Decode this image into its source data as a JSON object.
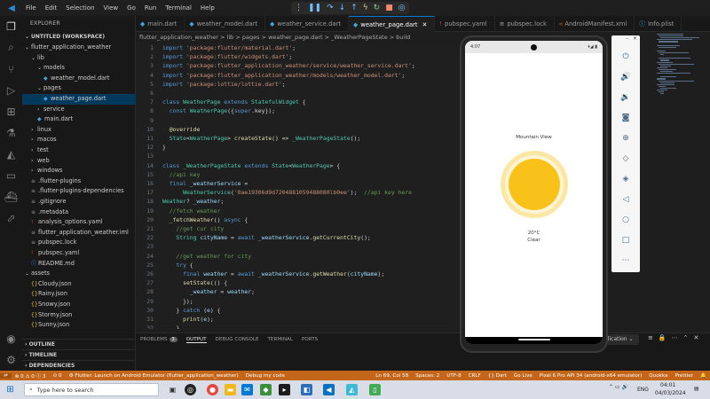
{
  "menu": [
    "File",
    "Edit",
    "Selection",
    "View",
    "Go",
    "Run",
    "Terminal",
    "Help"
  ],
  "explorer": {
    "title": "EXPLORER",
    "workspace": "UNTITLED (WORKSPACE)",
    "rows": [
      {
        "label": "flutter_application_weather",
        "depth": 0,
        "kind": "folder-open"
      },
      {
        "label": "lib",
        "depth": 1,
        "kind": "folder-open"
      },
      {
        "label": "models",
        "depth": 2,
        "kind": "folder-open"
      },
      {
        "label": "weather_model.dart",
        "depth": 3,
        "kind": "dart"
      },
      {
        "label": "pages",
        "depth": 2,
        "kind": "folder-open"
      },
      {
        "label": "weather_page.dart",
        "depth": 3,
        "kind": "dart",
        "selected": true
      },
      {
        "label": "service",
        "depth": 2,
        "kind": "folder"
      },
      {
        "label": "main.dart",
        "depth": 2,
        "kind": "dart"
      },
      {
        "label": "linux",
        "depth": 1,
        "kind": "folder"
      },
      {
        "label": "macos",
        "depth": 1,
        "kind": "folder"
      },
      {
        "label": "test",
        "depth": 1,
        "kind": "folder"
      },
      {
        "label": "web",
        "depth": 1,
        "kind": "folder"
      },
      {
        "label": "windows",
        "depth": 1,
        "kind": "folder"
      },
      {
        "label": ".flutter-plugins",
        "depth": 1,
        "kind": "file"
      },
      {
        "label": ".flutter-plugins-dependencies",
        "depth": 1,
        "kind": "file"
      },
      {
        "label": ".gitignore",
        "depth": 1,
        "kind": "file"
      },
      {
        "label": ".metadata",
        "depth": 1,
        "kind": "file"
      },
      {
        "label": "analysis_options.yaml",
        "depth": 1,
        "kind": "yaml"
      },
      {
        "label": "flutter_application_weather.iml",
        "depth": 1,
        "kind": "file"
      },
      {
        "label": "pubspec.lock",
        "depth": 1,
        "kind": "file"
      },
      {
        "label": "pubspec.yaml",
        "depth": 1,
        "kind": "yaml"
      },
      {
        "label": "README.md",
        "depth": 1,
        "kind": "info"
      },
      {
        "label": "assets",
        "depth": 0,
        "kind": "folder-open"
      },
      {
        "label": "Cloudy.json",
        "depth": 1,
        "kind": "json"
      },
      {
        "label": "Rainy.json",
        "depth": 1,
        "kind": "json"
      },
      {
        "label": "Snowy.json",
        "depth": 1,
        "kind": "json"
      },
      {
        "label": "Stormy.json",
        "depth": 1,
        "kind": "json"
      },
      {
        "label": "Sunny.json",
        "depth": 1,
        "kind": "json"
      }
    ],
    "sections": [
      "OUTLINE",
      "TIMELINE",
      "DEPENDENCIES"
    ]
  },
  "tabs": [
    {
      "label": "main.dart",
      "icon": "dart"
    },
    {
      "label": "weather_model.dart",
      "icon": "dart"
    },
    {
      "label": "weather_service.dart",
      "icon": "dart"
    },
    {
      "label": "weather_page.dart",
      "icon": "dart",
      "active": true
    },
    {
      "label": "pubspec.yaml",
      "icon": "yaml"
    },
    {
      "label": "pubspec.lock",
      "icon": "lock"
    },
    {
      "label": "AndroidManifest.xml",
      "icon": "xml"
    },
    {
      "label": "Info.plist",
      "icon": "plist"
    }
  ],
  "breadcrumb": "flutter_application_weather  >  lib  >  pages  >  weather_page.dart  >  _WeatherPageState  >  build",
  "code": [
    [
      [
        "kw",
        "import "
      ],
      [
        "str",
        "'package:flutter/material.dart'"
      ],
      [
        "pl",
        ";"
      ]
    ],
    [
      [
        "kw",
        "import "
      ],
      [
        "str",
        "'package:flutter/widgets.dart'"
      ],
      [
        "pl",
        ";"
      ]
    ],
    [
      [
        "kw",
        "import "
      ],
      [
        "str",
        "'package:flutter_application_weather/service/weather_service.dart'"
      ],
      [
        "pl",
        ";"
      ]
    ],
    [
      [
        "kw",
        "import "
      ],
      [
        "str",
        "'package:flutter_application_weather/models/weather_model.dart'"
      ],
      [
        "pl",
        ";"
      ]
    ],
    [
      [
        "kw",
        "import "
      ],
      [
        "str",
        "'package:lottie/lottie.dart'"
      ],
      [
        "pl",
        ";"
      ]
    ],
    [],
    [
      [
        "kw",
        "class "
      ],
      [
        "ty",
        "WeatherPage "
      ],
      [
        "kw",
        "extends "
      ],
      [
        "ty",
        "StatefulWidget "
      ],
      [
        "pl",
        "{"
      ]
    ],
    [
      [
        "pl",
        "  "
      ],
      [
        "kw",
        "const "
      ],
      [
        "ty",
        "WeatherPage"
      ],
      [
        "pl",
        "({"
      ],
      [
        "kw",
        "super"
      ],
      [
        "pl",
        ".key});"
      ]
    ],
    [],
    [
      [
        "pl",
        "  "
      ],
      [
        "an",
        "@override"
      ]
    ],
    [
      [
        "pl",
        "  "
      ],
      [
        "ty",
        "State"
      ],
      [
        "pl",
        "<"
      ],
      [
        "ty",
        "WeatherPage"
      ],
      [
        "pl",
        "> "
      ],
      [
        "fn",
        "createState"
      ],
      [
        "pl",
        "() => "
      ],
      [
        "ty",
        "_WeatherPageState"
      ],
      [
        "pl",
        "();"
      ]
    ],
    [
      [
        "pl",
        "}"
      ]
    ],
    [],
    [
      [
        "kw",
        "class "
      ],
      [
        "ty",
        "_WeatherPageState "
      ],
      [
        "kw",
        "extends "
      ],
      [
        "ty",
        "State"
      ],
      [
        "pl",
        "<"
      ],
      [
        "ty",
        "WeatherPage"
      ],
      [
        "pl",
        "> {"
      ]
    ],
    [
      [
        "pl",
        "  "
      ],
      [
        "cm",
        "//api key"
      ]
    ],
    [
      [
        "pl",
        "  "
      ],
      [
        "kw",
        "final "
      ],
      [
        "vr",
        "_weatherService "
      ],
      [
        "pl",
        "="
      ]
    ],
    [
      [
        "pl",
        "      "
      ],
      [
        "ty",
        "WeatherService"
      ],
      [
        "pl",
        "("
      ],
      [
        "str",
        "'0ae19306d9d7204881059488080lb0ee'"
      ],
      [
        "pl",
        ");  "
      ],
      [
        "cm",
        "//api key here"
      ]
    ],
    [
      [
        "ty",
        "Weather"
      ],
      [
        "pl",
        "? "
      ],
      [
        "vr",
        "_weather"
      ],
      [
        "pl",
        ";"
      ]
    ],
    [
      [
        "pl",
        "  "
      ],
      [
        "cm",
        "//fetch weather"
      ]
    ],
    [
      [
        "pl",
        "  "
      ],
      [
        "fn",
        "_fetchWeather"
      ],
      [
        "pl",
        "() "
      ],
      [
        "kw",
        "async "
      ],
      [
        "pl",
        "{"
      ]
    ],
    [
      [
        "pl",
        "    "
      ],
      [
        "cm",
        "//get cur city"
      ]
    ],
    [
      [
        "pl",
        "    "
      ],
      [
        "ty",
        "String "
      ],
      [
        "vr",
        "cityName "
      ],
      [
        "pl",
        "= "
      ],
      [
        "kw",
        "await "
      ],
      [
        "vr",
        "_weatherService"
      ],
      [
        "pl",
        "."
      ],
      [
        "fn",
        "getCurrentCity"
      ],
      [
        "pl",
        "();"
      ]
    ],
    [],
    [
      [
        "pl",
        "    "
      ],
      [
        "cm",
        "//get weather for city"
      ]
    ],
    [
      [
        "pl",
        "    "
      ],
      [
        "kw",
        "try "
      ],
      [
        "pl",
        "{"
      ]
    ],
    [
      [
        "pl",
        "      "
      ],
      [
        "kw",
        "final "
      ],
      [
        "vr",
        "weather "
      ],
      [
        "pl",
        "= "
      ],
      [
        "kw",
        "await "
      ],
      [
        "vr",
        "_weatherService"
      ],
      [
        "pl",
        "."
      ],
      [
        "fn",
        "getWeather"
      ],
      [
        "pl",
        "("
      ],
      [
        "vr",
        "cityName"
      ],
      [
        "pl",
        ");"
      ]
    ],
    [
      [
        "pl",
        "      "
      ],
      [
        "fn",
        "setState"
      ],
      [
        "pl",
        "(() {"
      ]
    ],
    [
      [
        "pl",
        "        "
      ],
      [
        "vr",
        "_weather "
      ],
      [
        "pl",
        "= "
      ],
      [
        "vr",
        "weather"
      ],
      [
        "pl",
        ";"
      ]
    ],
    [
      [
        "pl",
        "      });"
      ]
    ],
    [
      [
        "pl",
        "    } "
      ],
      [
        "kw",
        "catch "
      ],
      [
        "pl",
        "("
      ],
      [
        "vr",
        "e"
      ],
      [
        "pl",
        ") {"
      ]
    ],
    [
      [
        "pl",
        "      "
      ],
      [
        "fn",
        "print"
      ],
      [
        "pl",
        "("
      ],
      [
        "vr",
        "e"
      ],
      [
        "pl",
        ");"
      ]
    ],
    [
      [
        "pl",
        "    }"
      ]
    ],
    [
      [
        "pl",
        "  }"
      ]
    ]
  ],
  "panel": {
    "tabs": [
      "PROBLEMS",
      "OUTPUT",
      "DEBUG CONSOLE",
      "TERMINAL",
      "PORTS"
    ],
    "active": "OUTPUT",
    "problems_count": "3",
    "output_select": "plication"
  },
  "phone": {
    "status_left": "4:07",
    "city": "Mountain View",
    "temperature": "20°C",
    "condition": "Clear"
  },
  "status_bar": {
    "left": [
      "⊗ 0 ⚠ 0 ⓘ 3",
      "⊙ 0",
      "⚙ Flutter: Launch on Android Emulator (flutter_application_weather)",
      "Debug my code"
    ],
    "right": [
      "Ln 69, Col 58",
      "Spaces: 2",
      "UTF-8",
      "CRLF",
      "{} Dart",
      "Go Live",
      "Pixel 6 Pro API 34 (android-x64 emulator)",
      "Quokka",
      "Prettier"
    ]
  },
  "taskbar": {
    "search_placeholder": "Type here to search",
    "lang": "ENG",
    "time": "04:01",
    "date": "04/03/2024"
  }
}
